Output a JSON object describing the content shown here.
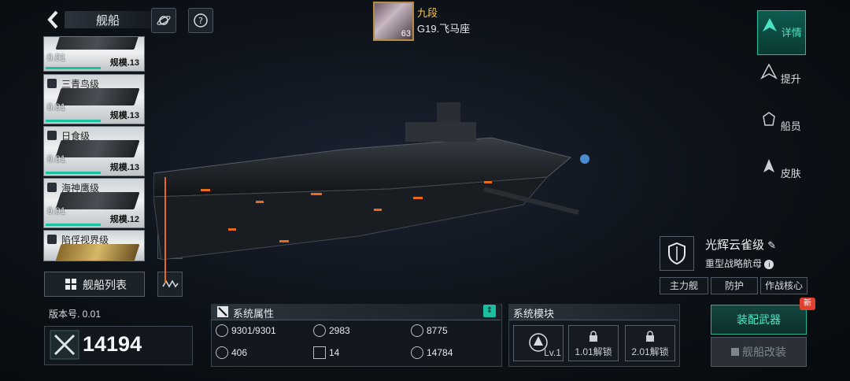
{
  "header": {
    "title": "舰船"
  },
  "player": {
    "name": "九段",
    "level": "63",
    "server": "G19.飞马座"
  },
  "ship_list": [
    {
      "name": "",
      "value": "0.01",
      "scale": "规模.13"
    },
    {
      "name": "三青鸟级",
      "value": "0.01",
      "scale": "规模.13"
    },
    {
      "name": "日食级",
      "value": "0.01",
      "scale": "规模.13"
    },
    {
      "name": "海神鹰级",
      "value": "0.01",
      "scale": "规模.12"
    },
    {
      "name": "陷俘视界级",
      "value": "0.01",
      "scale": ""
    }
  ],
  "fleet_list_label": "舰船列表",
  "tabs": [
    {
      "label": "详情",
      "active": true
    },
    {
      "label": "提升",
      "active": false
    },
    {
      "label": "船员",
      "active": false
    },
    {
      "label": "皮肤",
      "active": false
    }
  ],
  "ship_info": {
    "class_name": "光辉云雀级",
    "type": "重型战略航母",
    "tags": [
      "主力舰",
      "防护",
      "作战核心"
    ]
  },
  "power": {
    "version_label": "版本号. 0.01",
    "value": "14194"
  },
  "attributes": {
    "title": "系统属性",
    "values": [
      "9301/9301",
      "2983",
      "8775",
      "406",
      "14",
      "14784"
    ]
  },
  "modules": {
    "title": "系统模块",
    "slots": [
      "Lv.1",
      "1.01解锁",
      "2.01解锁"
    ]
  },
  "actions": {
    "equip_weapon": "装配武器",
    "refit_ship": "舰船改装",
    "new_badge": "新"
  },
  "colors": {
    "accent": "#1bbfa0",
    "gold": "#f2c34b",
    "badge": "#e0402f"
  }
}
